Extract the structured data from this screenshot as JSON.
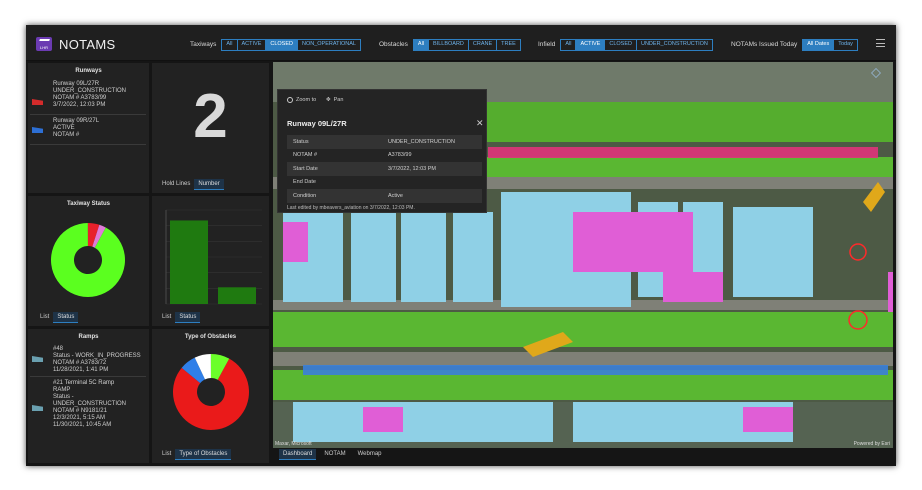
{
  "header": {
    "logo_text": "LHR",
    "title": "NOTAMS",
    "filters": [
      {
        "label": "Taxiways",
        "options": [
          "All",
          "ACTIVE",
          "CLOSED",
          "NON_OPERATIONAL"
        ],
        "selected": "CLOSED"
      },
      {
        "label": "Obstacles",
        "options": [
          "All",
          "BILLBOARD",
          "CRANE",
          "TREE"
        ],
        "selected": "All"
      },
      {
        "label": "Infield",
        "options": [
          "All",
          "ACTIVE",
          "CLOSED",
          "UNDER_CONSTRUCTION"
        ],
        "selected": "ACTIVE"
      },
      {
        "label": "NOTAMs Issued Today",
        "options": [
          "All Dates",
          "Today"
        ],
        "selected": "All Dates"
      }
    ]
  },
  "runways": {
    "title": "Runways",
    "items": [
      {
        "name": "Runway 09L/27R",
        "status": "UNDER_CONSTRUCTION",
        "notam": "NOTAM # A3783/99",
        "date": "3/7/2022, 12:03 PM",
        "color": "#d42b2b"
      },
      {
        "name": "Runway 09R/27L",
        "status": "ACTIVE",
        "notam": "NOTAM #",
        "color": "#2d6fd4"
      }
    ]
  },
  "hold_lines": {
    "value": "2",
    "tabs": [
      "Hold Lines",
      "Number"
    ],
    "active_tab": "Number"
  },
  "taxiway_status": {
    "title": "Taxiway Status",
    "tabs": [
      "List",
      "Status"
    ],
    "active_tab": "Status"
  },
  "status_bars": {
    "tabs": [
      "List",
      "Status"
    ],
    "active_tab": "Status"
  },
  "ramps": {
    "title": "Ramps",
    "items": [
      {
        "lines": [
          "#48",
          "Status - WORK_IN_PROGRESS",
          "NOTAM # A3783/72",
          "11/28/2021, 1:41 PM"
        ]
      },
      {
        "lines": [
          "#21 Terminal 5C Ramp",
          "RAMP",
          "Status -",
          "UNDER_CONSTRUCTION",
          "NOTAM # N9181/21",
          "12/3/2021, 5:15 AM",
          "11/30/2021, 10:45 AM"
        ]
      }
    ]
  },
  "obstacles": {
    "title": "Type of Obstacles",
    "tabs": [
      "List",
      "Type of Obstacles"
    ],
    "active_tab": "Type of Obstacles"
  },
  "chart_data": [
    {
      "type": "pie",
      "title": "Taxiway Status",
      "style": "donut",
      "slices": [
        {
          "value": 92,
          "color": "#5bff1f"
        },
        {
          "value": 5,
          "color": "#e8212b"
        },
        {
          "value": 3,
          "color": "#e07bd8"
        }
      ]
    },
    {
      "type": "bar",
      "categories": [
        "",
        ""
      ],
      "values": [
        8,
        1.6
      ],
      "ylim": [
        0,
        9
      ],
      "color": "#1f7a10",
      "grid": true
    },
    {
      "type": "pie",
      "title": "Type of Obstacles",
      "style": "donut",
      "slices": [
        {
          "value": 78,
          "color": "#ea1a1a"
        },
        {
          "value": 7,
          "color": "#2f7fe8"
        },
        {
          "value": 7,
          "color": "#ffffff"
        },
        {
          "value": 8,
          "color": "#6bff2a"
        }
      ]
    }
  ],
  "map": {
    "zoom_label": "Zoom to",
    "pan_label": "Pan",
    "attribution_left": "Maxar, Microsoft",
    "attribution_right": "Powered by Esri",
    "popup": {
      "title": "Runway 09L/27R",
      "rows": [
        {
          "field": "Status",
          "value": "UNDER_CONSTRUCTION"
        },
        {
          "field": "NOTAM #",
          "value": "A3783/99"
        },
        {
          "field": "Start Date",
          "value": "3/7/2022, 12:03 PM"
        },
        {
          "field": "End Date",
          "value": ""
        },
        {
          "field": "Condition",
          "value": "Active"
        }
      ],
      "footer": "Last edited by mbeavers_aviation on 3/7/2022, 12:03 PM."
    }
  },
  "bottom_tabs": [
    "Dashboard",
    "NOTAM",
    "Webmap"
  ],
  "bottom_active": "Dashboard"
}
